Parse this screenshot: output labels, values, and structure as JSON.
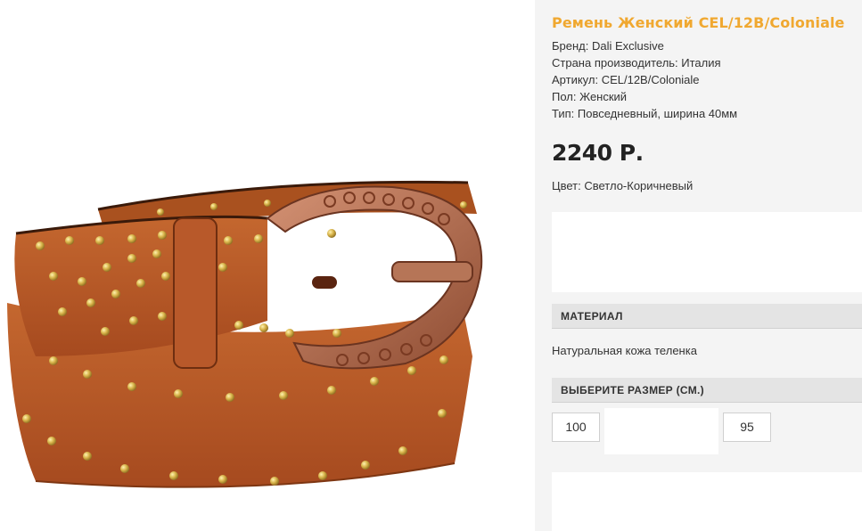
{
  "product": {
    "title": "Ремень Женский CEL/12B/Coloniale",
    "brand": "Бренд: Dali Exclusive",
    "country": "Страна производитель: Италия",
    "article": "Артикул: CEL/12B/Coloniale",
    "gender": "Пол: Женский",
    "type": "Тип: Повседневный, ширина 40мм",
    "price": "2240 Р.",
    "color": "Цвет: Светло-Коричневый"
  },
  "material_section": {
    "heading": "МАТЕРИАЛ",
    "value": "Натуральная кожа теленка"
  },
  "size_section": {
    "heading": "ВЫБЕРИТЕ РАЗМЕР (СМ.)",
    "sizes": [
      "100",
      "95"
    ]
  },
  "colors": {
    "title_accent": "#f0a830",
    "leather": "#b5562a",
    "buckle": "#b06b4c",
    "stud": "#d8b44a"
  }
}
